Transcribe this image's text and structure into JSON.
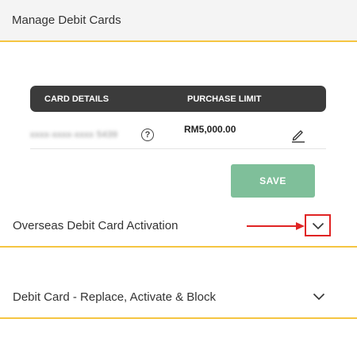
{
  "header": {
    "title": "Manage Debit Cards"
  },
  "card_table": {
    "col_card_details": "CARD DETAILS",
    "col_purchase_limit": "PURCHASE LIMIT",
    "rows": [
      {
        "card_number": "xxxx-xxxx-xxxx 5439",
        "purchase_limit": "RM5,000.00"
      }
    ]
  },
  "actions": {
    "save_label": "SAVE"
  },
  "sections": [
    {
      "label": "Overseas Debit Card Activation",
      "expanded": false,
      "highlighted": true
    },
    {
      "label": "Debit Card - Replace, Activate & Block",
      "expanded": false
    }
  ],
  "icons": {
    "help": "help-circle-icon",
    "edit": "pencil-icon",
    "chevron": "chevron-down-icon",
    "annotation": "red-arrow"
  },
  "colors": {
    "accent_border": "#f5c542",
    "save_button": "#7fbf9a",
    "table_header": "#3b3b3b",
    "annotation": "#e02424"
  }
}
